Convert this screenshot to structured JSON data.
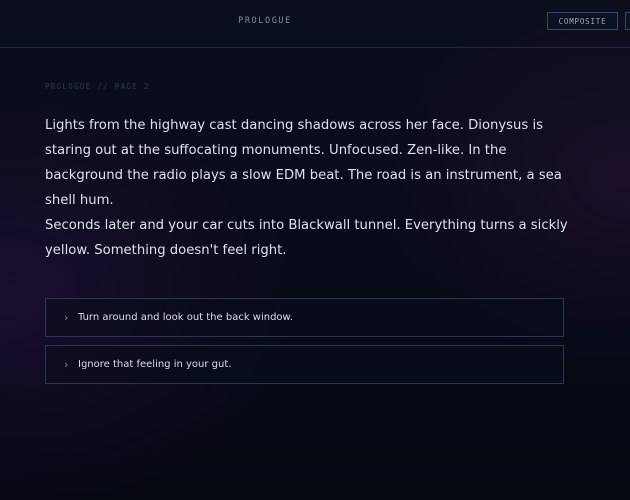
{
  "header": {
    "title": "PROLOGUE",
    "composite_label": "COMPOSITE"
  },
  "page": {
    "label": "PROLOGUE // PAGE 2"
  },
  "story": {
    "paragraphs": [
      "Lights from the highway cast dancing shadows across her face. Dionysus is staring out at the suffocating monuments. Unfocused. Zen-like. In the background the radio plays a slow EDM beat. The road is an instrument, a sea shell hum.",
      "Seconds later and your car cuts into Blackwall tunnel. Everything turns a sickly yellow. Something doesn't feel right."
    ]
  },
  "choices": [
    {
      "icon": "chevron-right-icon",
      "marker": "›",
      "label": "Turn around and look out the back window."
    },
    {
      "icon": "chevron-right-icon",
      "marker": "›",
      "label": "Ignore that feeling in your gut."
    }
  ],
  "colors": {
    "background": "#080b18",
    "text": "#dde1ee",
    "border": "#2c3652",
    "accent": "#6f86b8"
  }
}
